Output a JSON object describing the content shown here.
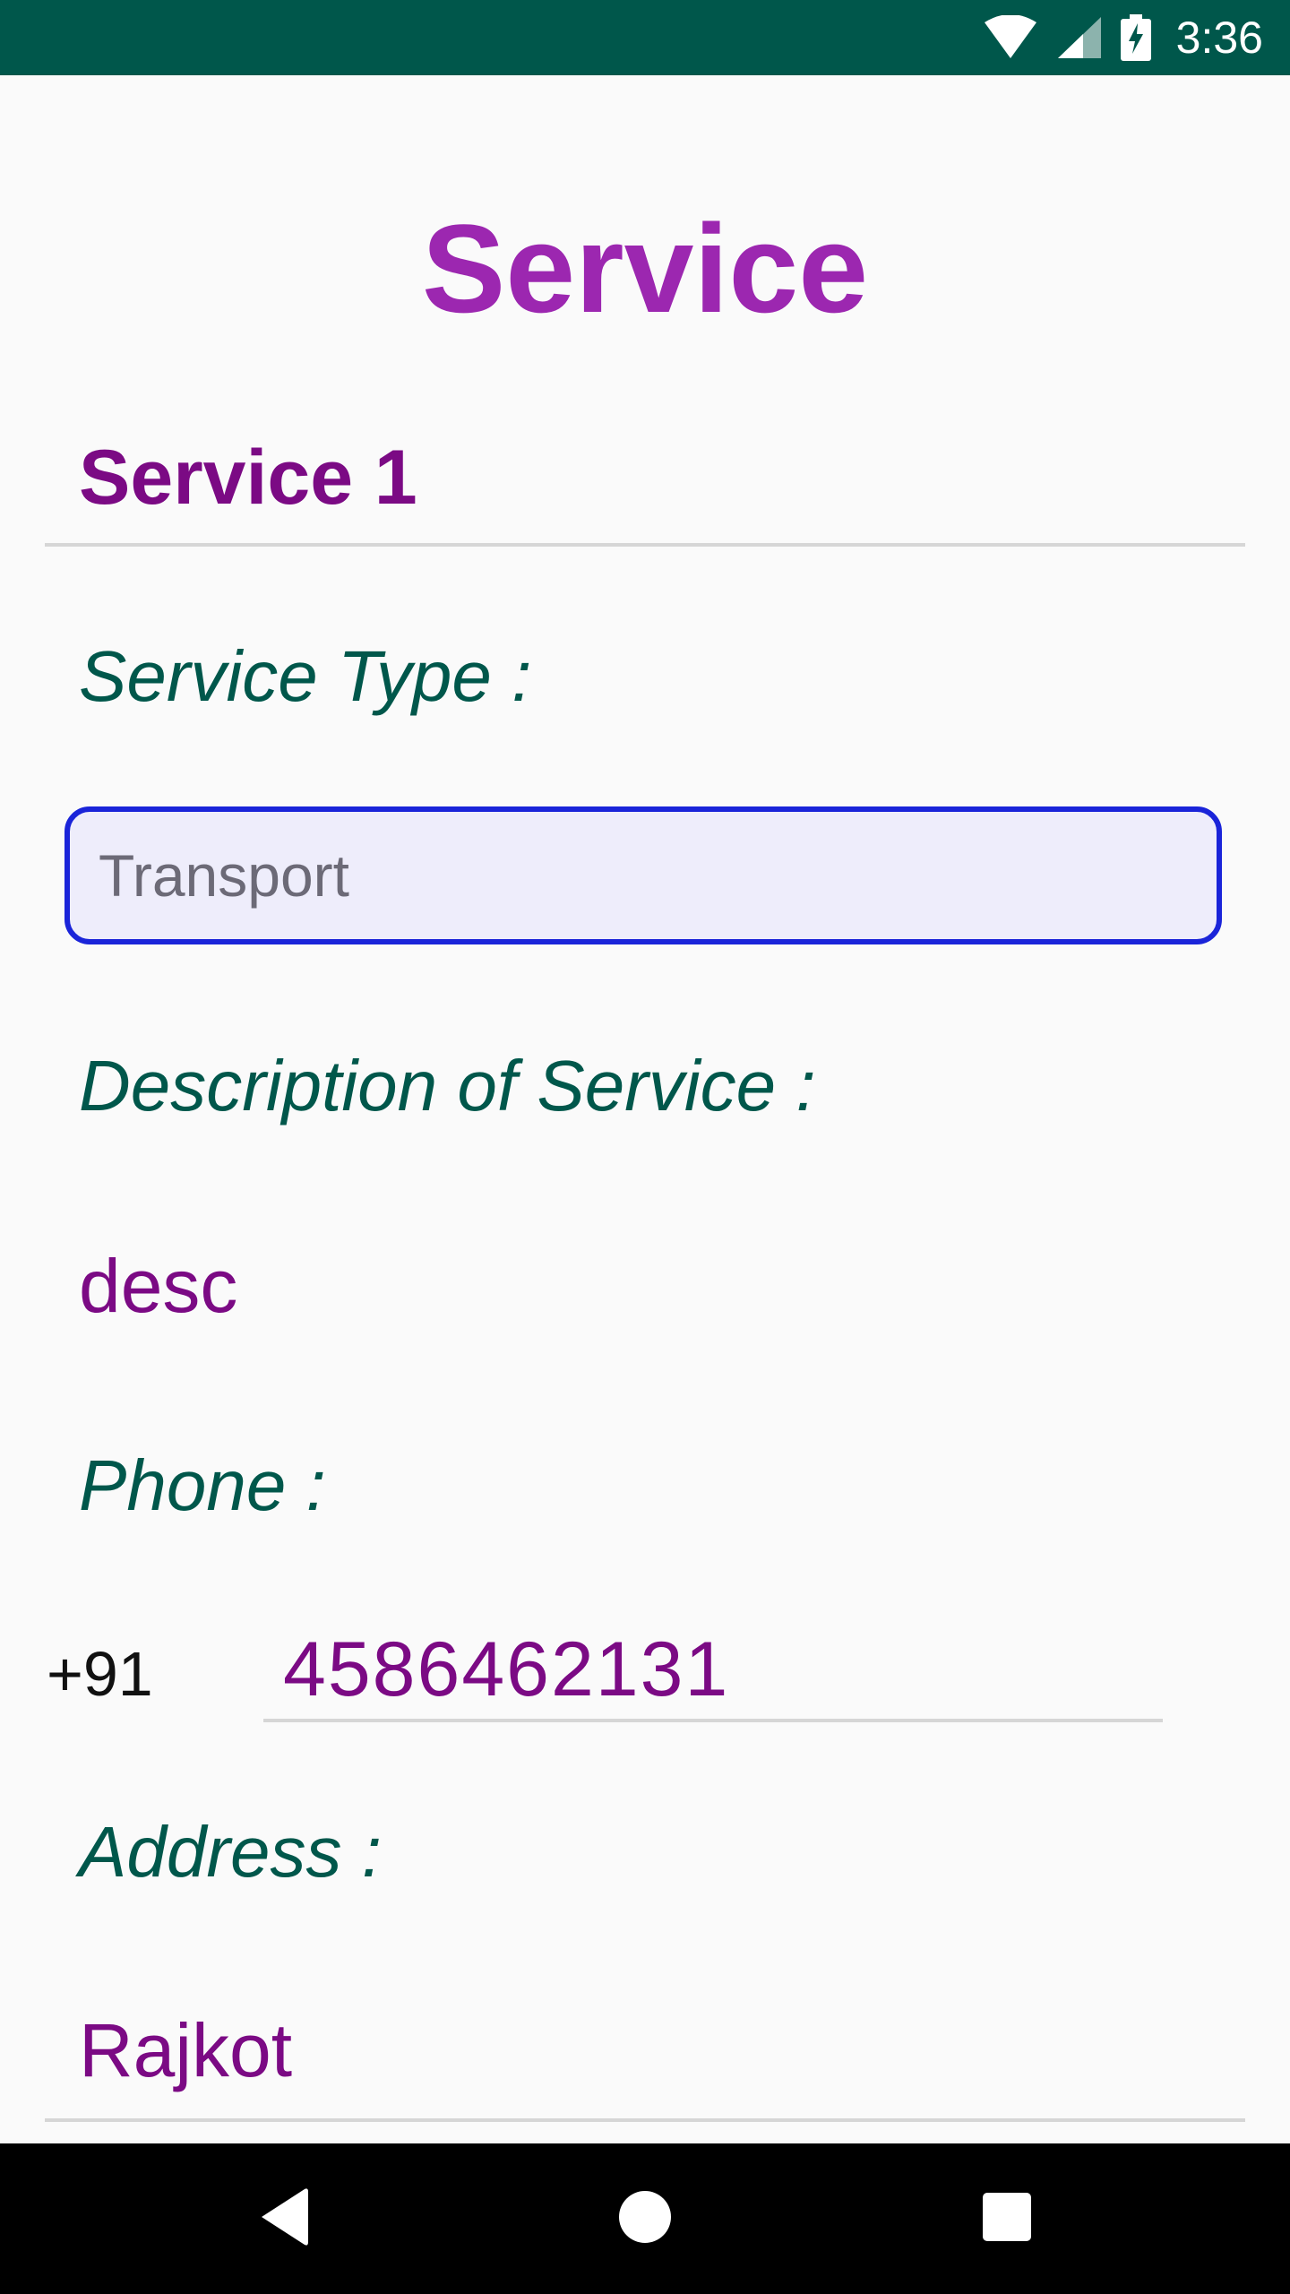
{
  "status_bar": {
    "time": "3:36",
    "icons": [
      "wifi-icon",
      "cell-signal-icon",
      "battery-charging-icon"
    ],
    "background_color": "#00574b"
  },
  "page": {
    "title": "Service",
    "title_color": "#9c27b0",
    "service_name": "Service 1"
  },
  "fields": {
    "service_type_label": "Service Type :",
    "service_type_value": "Transport",
    "description_label": "Description of Service :",
    "description_value": "desc",
    "phone_label": "Phone :",
    "country_code": "+91",
    "phone_value": "4586462131",
    "address_label": "Address :",
    "address_value": "Rajkot"
  },
  "colors": {
    "label_color": "#00574b",
    "value_color": "#7b0a84",
    "input_border": "#1a24d9",
    "input_fill": "#eeedfb"
  },
  "nav_bar": {
    "icons": [
      "back-icon",
      "home-icon",
      "recents-icon"
    ]
  }
}
